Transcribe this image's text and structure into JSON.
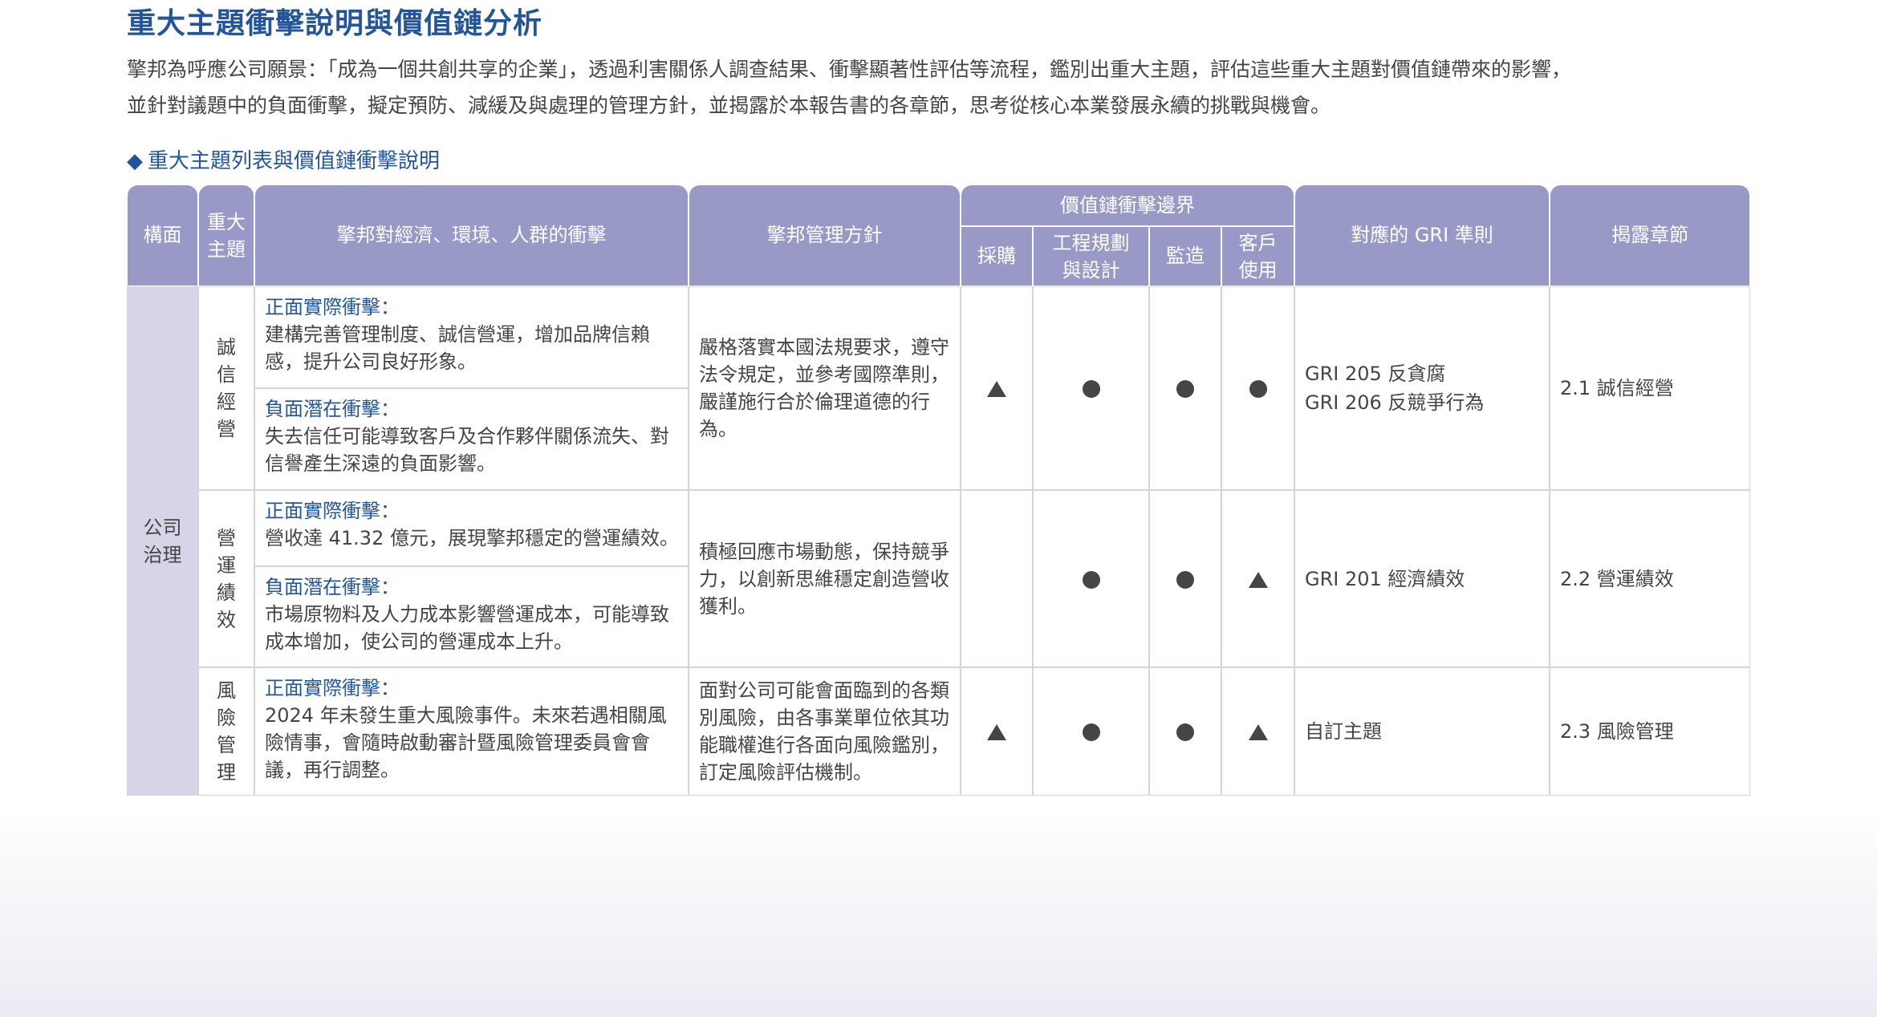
{
  "title": "重大主題衝擊說明與價值鏈分析",
  "intro": [
    "擎邦為呼應公司願景：「成為一個共創共享的企業」，透過利害關係人調查結果、衝擊顯著性評估等流程，鑑別出重大主題，評估這些重大主題對價值鏈帶來的影響，",
    "並針對議題中的負面衝擊，擬定預防、減緩及與處理的管理方針，並揭露於本報告書的各章節，思考從核心本業發展永續的挑戰與機會。"
  ],
  "section_heading": "重大主題列表與價值鏈衝擊說明",
  "table": {
    "headers": {
      "dimension": "構面",
      "topic": "重大主題",
      "impact": "擎邦對經濟、環境、人群的衝擊",
      "policy": "擎邦管理方針",
      "value_chain": "價值鏈衝擊邊界",
      "procurement": "採購",
      "engineering": "工程規劃與設計",
      "supervision": "監造",
      "customer_use": "客戶使用",
      "gri": "對應的 GRI 準則",
      "disclosure": "揭露章節"
    },
    "dimension_value": "公司治理",
    "rows": [
      {
        "topic": "誠信經營",
        "positive_label": "正面實際衝擊：",
        "positive_text": "建構完善管理制度、誠信營運，增加品牌信賴感，提升公司良好形象。",
        "negative_label": "負面潛在衝擊：",
        "negative_text": "失去信任可能導致客戶及合作夥伴關係流失、對信譽產生深遠的負面影響。",
        "policy": "嚴格落實本國法規要求，遵守法令規定，並參考國際準則，嚴謹施行合於倫理道德的行為。",
        "marks": {
          "procurement": "triangle",
          "engineering": "circle",
          "supervision": "circle",
          "customer_use": "circle"
        },
        "gri": [
          "GRI 205 反貪腐",
          "GRI 206 反競爭行為"
        ],
        "disclosure": "2.1 誠信經營"
      },
      {
        "topic": "營運績效",
        "positive_label": "正面實際衝擊：",
        "positive_text": "營收達 41.32 億元，展現擎邦穩定的營運績效。",
        "negative_label": "負面潛在衝擊：",
        "negative_text": "市場原物料及人力成本影響營運成本，可能導致成本增加，使公司的營運成本上升。",
        "policy": "積極回應市場動態，保持競爭力，以創新思維穩定創造營收獲利。",
        "marks": {
          "procurement": "",
          "engineering": "circle",
          "supervision": "circle",
          "customer_use": "triangle"
        },
        "gri": [
          "GRI 201 經濟績效"
        ],
        "disclosure": "2.2 營運績效"
      },
      {
        "topic": "風險管理",
        "positive_label": "正面實際衝擊：",
        "positive_text": "2024 年未發生重大風險事件。未來若遇相關風險情事，會隨時啟動審計暨風險管理委員會會議，再行調整。",
        "policy": "面對公司可能會面臨到的各類別風險，由各事業單位依其功能職權進行各面向風險鑑別，訂定風險評估機制。",
        "marks": {
          "procurement": "triangle",
          "engineering": "circle",
          "supervision": "circle",
          "customer_use": "triangle"
        },
        "gri": [
          "自訂主題"
        ],
        "disclosure": "2.3 風險管理"
      }
    ]
  },
  "colors": {
    "title_blue": "#22559a",
    "header_purple": "#9899c6",
    "dimension_lavender": "#d6d5e8",
    "border": "#d3d3e6",
    "text": "#454545"
  }
}
